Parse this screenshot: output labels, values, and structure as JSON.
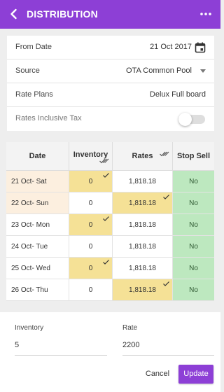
{
  "appbar": {
    "title": "DISTRIBUTION",
    "back_icon": "arrow-left-icon",
    "more_icon": "more-horizontal-icon",
    "color": "#8d3fd6"
  },
  "form": {
    "from_date": {
      "label": "From Date",
      "value": "21 Oct 2017",
      "icon": "calendar-icon"
    },
    "source": {
      "label": "Source",
      "value": "OTA Common Pool",
      "icon": "caret-down-icon"
    },
    "rate_plans": {
      "label": "Rate Plans",
      "value": "Delux Full board"
    },
    "rates_inclusive_tax": {
      "label": "Rates Inclusive Tax",
      "on": false
    }
  },
  "grid": {
    "headers": {
      "date": "Date",
      "inventory": "Inventory",
      "rates": "Rates",
      "stop_sell": "Stop Sell"
    },
    "rows": [
      {
        "date": "21 Oct- Sat",
        "inventory": "0",
        "rate": "1,818.18",
        "stop_sell": "No"
      },
      {
        "date": "22 Oct- Sun",
        "inventory": "0",
        "rate": "1,818.18",
        "stop_sell": "No"
      },
      {
        "date": "23 Oct- Mon",
        "inventory": "0",
        "rate": "1,818.18",
        "stop_sell": "No"
      },
      {
        "date": "24 Oct- Tue",
        "inventory": "0",
        "rate": "1,818.18",
        "stop_sell": "No"
      },
      {
        "date": "25 Oct- Wed",
        "inventory": "0",
        "rate": "1,818.18",
        "stop_sell": "No"
      },
      {
        "date": "26 Oct- Thu",
        "inventory": "0",
        "rate": "1,818.18",
        "stop_sell": "No"
      }
    ]
  },
  "editor": {
    "inventory": {
      "label": "Inventory",
      "value": "5"
    },
    "rate": {
      "label": "Rate",
      "value": "2200"
    },
    "cancel_label": "Cancel",
    "update_label": "Update"
  },
  "colors": {
    "accent": "#8d3fd6",
    "selected_yellow": "#f5e196",
    "stop_sell_green": "#bde8bf",
    "highlight_row": "#fcefdf"
  }
}
